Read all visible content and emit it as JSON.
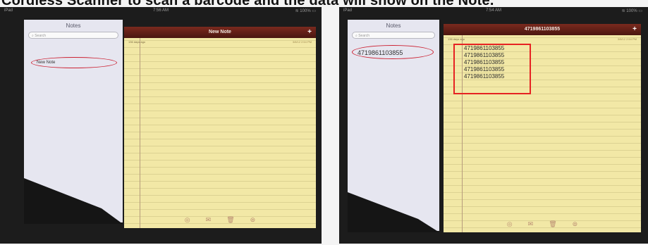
{
  "caption": "Cordless Scanner to scan a barcode and the data will show on the Note.",
  "left": {
    "status": {
      "carrier": "iPad",
      "time": "7:56 AM",
      "battery": "≋ 100% ▭"
    },
    "sidebar": {
      "title": "Notes",
      "search_placeholder": "Search",
      "selected_note": "New Note"
    },
    "note": {
      "title": "New Note",
      "add": "+",
      "meta": "136 days ago",
      "date": "3/8/12  2:54 PM"
    }
  },
  "right": {
    "status": {
      "carrier": "iPad",
      "time": "7:54 AM",
      "battery": "≋ 100% ▭"
    },
    "sidebar": {
      "title": "Notes",
      "search_placeholder": "Search",
      "selected_note": "4719861103855"
    },
    "note": {
      "title": "4719861103855",
      "add": "+",
      "meta": "136 days ago",
      "date": "3/8/12  2:54 PM",
      "lines": [
        "4719861103855",
        "4719861103855",
        "4719861103855",
        "4719861103855",
        "4719861103855"
      ]
    }
  },
  "toolbar_icons": [
    "compass-icon",
    "mail-icon",
    "trash-icon",
    "forward-icon"
  ],
  "colors": {
    "highlight": "#e62222",
    "titlebar": "#5a1d14",
    "paper": "#f2e8a6"
  }
}
